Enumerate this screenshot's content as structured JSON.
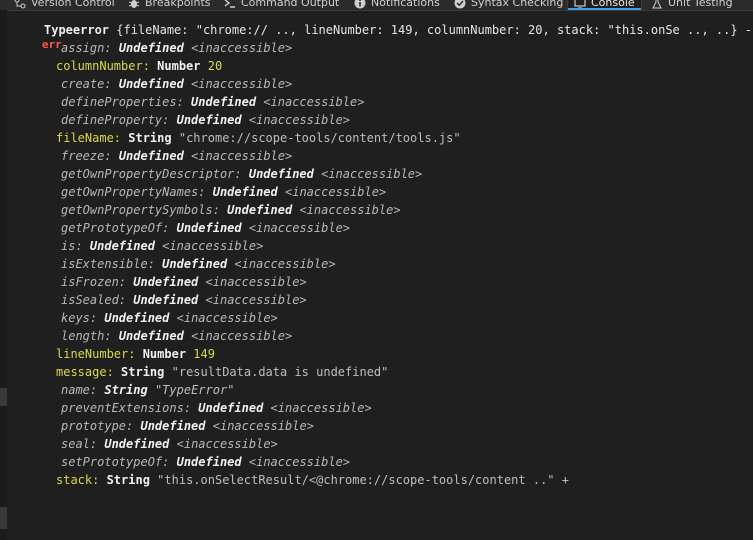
{
  "tabs": [
    {
      "label": "Version Control",
      "icon": "version-control-icon"
    },
    {
      "label": "Breakpoints",
      "icon": "bug-icon"
    },
    {
      "label": "Command Output",
      "icon": "terminal-icon"
    },
    {
      "label": "Notifications",
      "icon": "info-icon"
    },
    {
      "label": "Syntax Checking",
      "icon": "check-icon"
    },
    {
      "label": "Console",
      "icon": "console-icon",
      "active": true
    },
    {
      "label": "Unit Testing",
      "icon": "flask-icon"
    }
  ],
  "console": {
    "level": "err",
    "summary_type": "Typeerror",
    "summary_rest": " {fileName: \"chrome:// .., lineNumber: 149, columnNumber: 20, stack: \"this.onSe .., ..} -",
    "props": [
      {
        "key": "assign",
        "type": "Undefined",
        "value": "<inaccessible>",
        "own": false
      },
      {
        "key": "columnNumber",
        "type": "Number",
        "value": "20",
        "own": true,
        "kind": "num"
      },
      {
        "key": "create",
        "type": "Undefined",
        "value": "<inaccessible>",
        "own": false
      },
      {
        "key": "defineProperties",
        "type": "Undefined",
        "value": "<inaccessible>",
        "own": false
      },
      {
        "key": "defineProperty",
        "type": "Undefined",
        "value": "<inaccessible>",
        "own": false
      },
      {
        "key": "fileName",
        "type": "String",
        "value": "\"chrome://scope-tools/content/tools.js\"",
        "own": true,
        "kind": "str"
      },
      {
        "key": "freeze",
        "type": "Undefined",
        "value": "<inaccessible>",
        "own": false
      },
      {
        "key": "getOwnPropertyDescriptor",
        "type": "Undefined",
        "value": "<inaccessible>",
        "own": false
      },
      {
        "key": "getOwnPropertyNames",
        "type": "Undefined",
        "value": "<inaccessible>",
        "own": false
      },
      {
        "key": "getOwnPropertySymbols",
        "type": "Undefined",
        "value": "<inaccessible>",
        "own": false
      },
      {
        "key": "getPrototypeOf",
        "type": "Undefined",
        "value": "<inaccessible>",
        "own": false
      },
      {
        "key": "is",
        "type": "Undefined",
        "value": "<inaccessible>",
        "own": false
      },
      {
        "key": "isExtensible",
        "type": "Undefined",
        "value": "<inaccessible>",
        "own": false
      },
      {
        "key": "isFrozen",
        "type": "Undefined",
        "value": "<inaccessible>",
        "own": false
      },
      {
        "key": "isSealed",
        "type": "Undefined",
        "value": "<inaccessible>",
        "own": false
      },
      {
        "key": "keys",
        "type": "Undefined",
        "value": "<inaccessible>",
        "own": false
      },
      {
        "key": "length",
        "type": "Undefined",
        "value": "<inaccessible>",
        "own": false
      },
      {
        "key": "lineNumber",
        "type": "Number",
        "value": "149",
        "own": true,
        "kind": "num"
      },
      {
        "key": "message",
        "type": "String",
        "value": "\"resultData.data is undefined\"",
        "own": true,
        "kind": "str"
      },
      {
        "key": "name",
        "type": "String",
        "value": "\"TypeError\"",
        "own": false,
        "kind": "str"
      },
      {
        "key": "preventExtensions",
        "type": "Undefined",
        "value": "<inaccessible>",
        "own": false
      },
      {
        "key": "prototype",
        "type": "Undefined",
        "value": "<inaccessible>",
        "own": false
      },
      {
        "key": "seal",
        "type": "Undefined",
        "value": "<inaccessible>",
        "own": false
      },
      {
        "key": "setPrototypeOf",
        "type": "Undefined",
        "value": "<inaccessible>",
        "own": false
      },
      {
        "key": "stack",
        "type": "String",
        "value": "\"this.onSelectResult/<@chrome://scope-tools/content ..\" +",
        "own": true,
        "kind": "str"
      }
    ]
  },
  "colors": {
    "accent": "#3c9cf0",
    "error": "#ff5555",
    "own_key": "#d8d84a"
  }
}
